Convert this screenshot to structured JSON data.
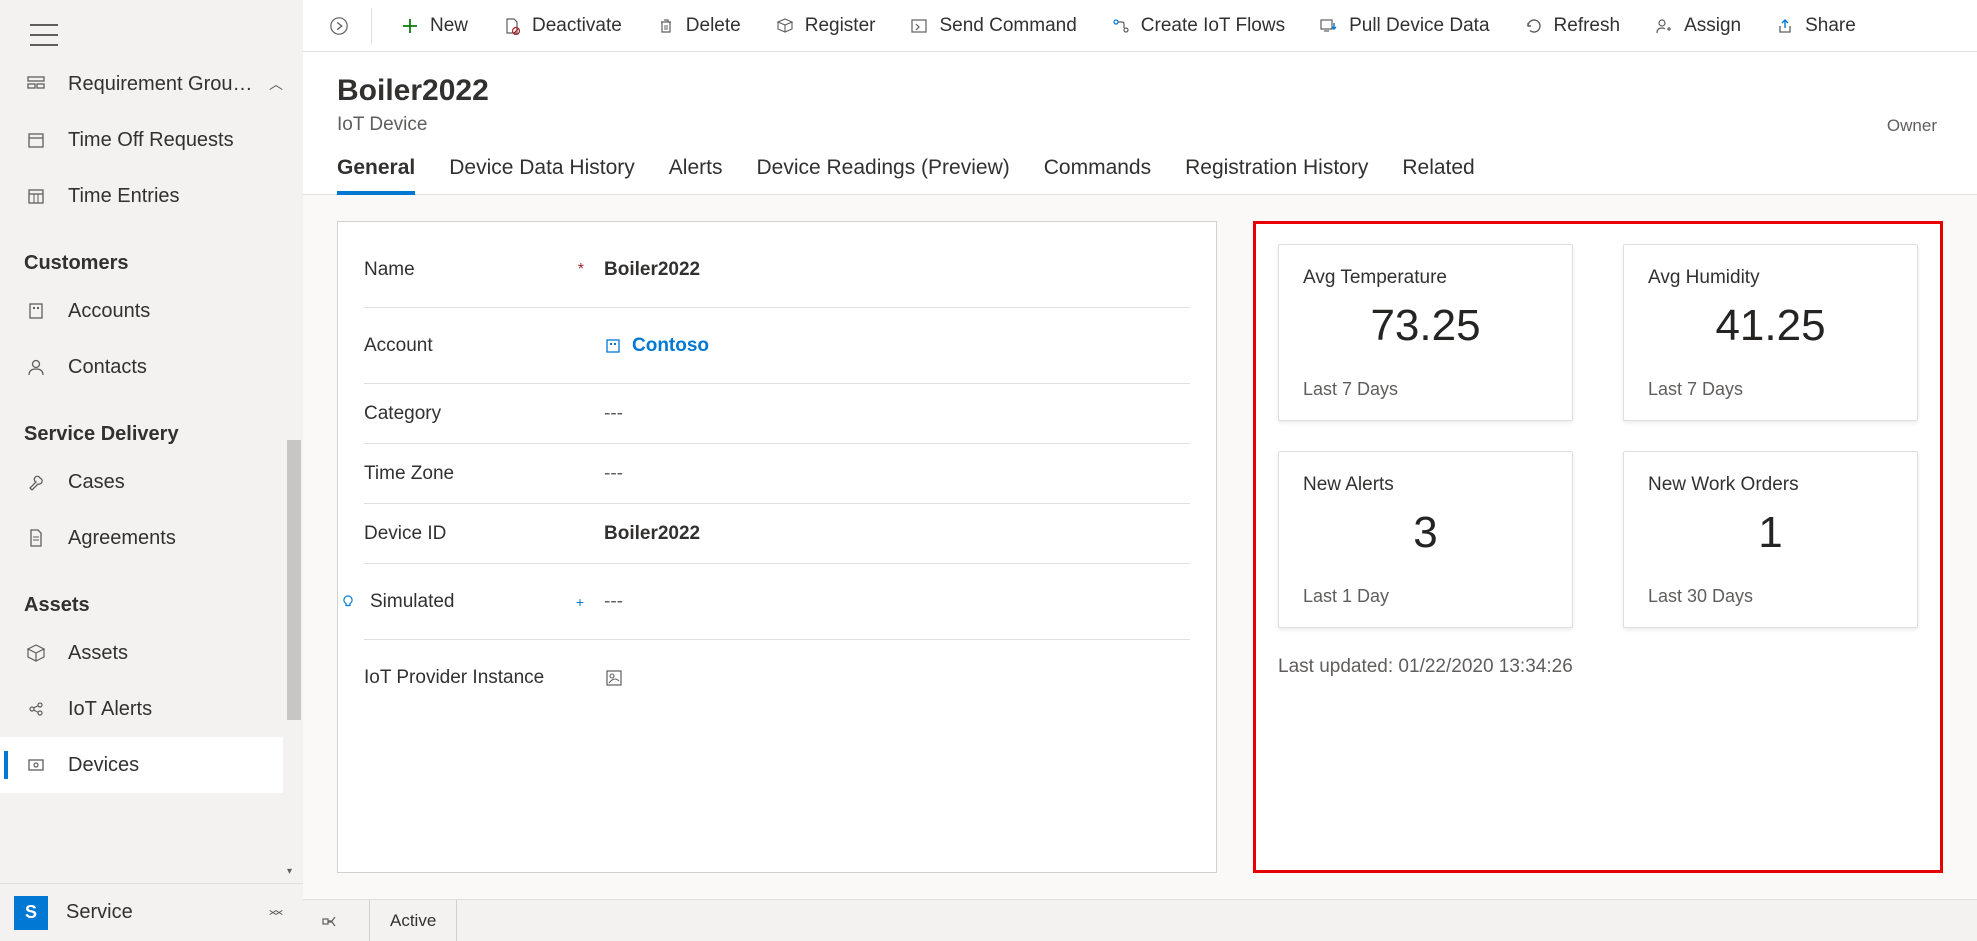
{
  "sidebar": {
    "top_items": [
      {
        "label": "Requirement Grou…",
        "icon": "group"
      },
      {
        "label": "Time Off Requests",
        "icon": "calendar"
      },
      {
        "label": "Time Entries",
        "icon": "calendar-grid"
      }
    ],
    "sections": [
      {
        "title": "Customers",
        "items": [
          {
            "label": "Accounts",
            "icon": "building"
          },
          {
            "label": "Contacts",
            "icon": "person"
          }
        ]
      },
      {
        "title": "Service Delivery",
        "items": [
          {
            "label": "Cases",
            "icon": "wrench"
          },
          {
            "label": "Agreements",
            "icon": "document"
          }
        ]
      },
      {
        "title": "Assets",
        "items": [
          {
            "label": "Assets",
            "icon": "cube"
          },
          {
            "label": "IoT Alerts",
            "icon": "alert"
          },
          {
            "label": "Devices",
            "icon": "device",
            "active": true
          }
        ]
      }
    ],
    "footer": {
      "badge": "S",
      "label": "Service"
    }
  },
  "toolbar": {
    "items": [
      {
        "label": "New",
        "icon": "plus",
        "color": "#107c10"
      },
      {
        "label": "Deactivate",
        "icon": "deactivate"
      },
      {
        "label": "Delete",
        "icon": "trash"
      },
      {
        "label": "Register",
        "icon": "register"
      },
      {
        "label": "Send Command",
        "icon": "send"
      },
      {
        "label": "Create IoT Flows",
        "icon": "flow"
      },
      {
        "label": "Pull Device Data",
        "icon": "pull"
      },
      {
        "label": "Refresh",
        "icon": "refresh"
      },
      {
        "label": "Assign",
        "icon": "assign"
      },
      {
        "label": "Share",
        "icon": "share"
      }
    ]
  },
  "header": {
    "title": "Boiler2022",
    "subtitle": "IoT Device",
    "owner": "Owner"
  },
  "tabs": [
    {
      "label": "General",
      "active": true
    },
    {
      "label": "Device Data History"
    },
    {
      "label": "Alerts"
    },
    {
      "label": "Device Readings (Preview)"
    },
    {
      "label": "Commands"
    },
    {
      "label": "Registration History"
    },
    {
      "label": "Related"
    }
  ],
  "form": {
    "rows": [
      {
        "label": "Name",
        "value": "Boiler2022",
        "required": true
      },
      {
        "label": "Account",
        "value": "Contoso",
        "link": true,
        "hasIcon": true
      },
      {
        "label": "Category",
        "value": "---",
        "empty": true
      },
      {
        "label": "Time Zone",
        "value": "---",
        "empty": true
      },
      {
        "label": "Device ID",
        "value": "Boiler2022"
      },
      {
        "label": "Simulated",
        "value": "---",
        "empty": true,
        "bulb": true,
        "plus": true
      },
      {
        "label": "IoT Provider Instance",
        "value": "",
        "iconValue": true
      }
    ]
  },
  "cards": [
    {
      "title": "Avg Temperature",
      "value": "73.25",
      "sub": "Last 7 Days"
    },
    {
      "title": "Avg Humidity",
      "value": "41.25",
      "sub": "Last 7 Days"
    },
    {
      "title": "New Alerts",
      "value": "3",
      "sub": "Last 1 Day"
    },
    {
      "title": "New Work Orders",
      "value": "1",
      "sub": "Last 30 Days"
    }
  ],
  "cards_footer": "Last updated: 01/22/2020 13:34:26",
  "footer": {
    "status": "Active"
  }
}
